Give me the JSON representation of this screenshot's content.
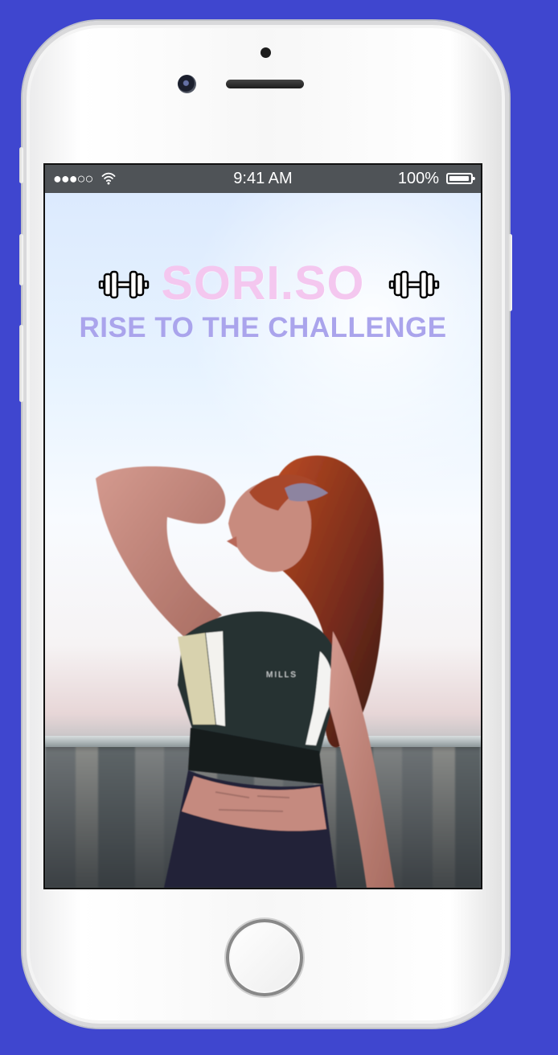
{
  "status_bar": {
    "signal": "●●●○○",
    "time": "9:41 AM",
    "battery": "100%"
  },
  "hero": {
    "brand": "SORI.SO",
    "tagline": "RISE TO THE CHALLENGE",
    "shirt_text": "MILLS"
  },
  "icons": {
    "left_dumbbell": "dumbbell-icon",
    "right_dumbbell": "dumbbell-icon",
    "wifi": "wifi-icon",
    "battery": "battery-icon"
  },
  "colors": {
    "background": "#3f46cf",
    "brand": "#f4c7ef",
    "tagline": "#aaa4ec",
    "status_bar": "#4f5357"
  }
}
